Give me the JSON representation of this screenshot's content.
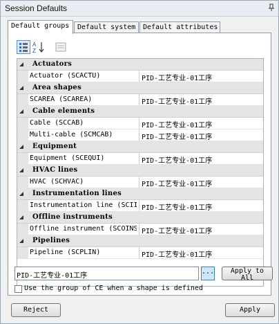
{
  "window": {
    "title": "Session Defaults"
  },
  "tabs": [
    {
      "label": "Default groups",
      "active": true
    },
    {
      "label": "Default system",
      "active": false
    },
    {
      "label": "Default attributes",
      "active": false
    }
  ],
  "toolbar": {
    "icons": [
      "categorized-view-icon",
      "sort-alphabetical-icon",
      "property-pages-icon"
    ]
  },
  "groups": [
    {
      "label": "Actuators",
      "items": [
        {
          "name": "Actuator (SCACTU)",
          "value": "PID-工艺专业-01工序"
        }
      ]
    },
    {
      "label": "Area shapes",
      "items": [
        {
          "name": "SCAREA (SCAREA)",
          "value": "PID-工艺专业-01工序"
        }
      ]
    },
    {
      "label": "Cable elements",
      "items": [
        {
          "name": "Cable (SCCAB)",
          "value": "PID-工艺专业-01工序"
        },
        {
          "name": "Multi-cable (SCMCAB)",
          "value": "PID-工艺专业-01工序"
        }
      ]
    },
    {
      "label": "Equipment",
      "items": [
        {
          "name": "Equipment (SCEQUI)",
          "value": "PID-工艺专业-01工序"
        }
      ]
    },
    {
      "label": "HVAC lines",
      "items": [
        {
          "name": "HVAC (SCHVAC)",
          "value": "PID-工艺专业-01工序"
        }
      ]
    },
    {
      "label": "Instrumentation lines",
      "items": [
        {
          "name": "Instrumentation line (SCII",
          "value": "PID-工艺专业-01工序"
        }
      ]
    },
    {
      "label": "Offline instruments",
      "items": [
        {
          "name": "Offline instrument (SCOINS",
          "value": "PID-工艺专业-01工序"
        }
      ]
    },
    {
      "label": "Pipelines",
      "items": [
        {
          "name": "Pipeline (SCPLIN)",
          "value": "PID-工艺专业-01工序"
        }
      ]
    }
  ],
  "value_editor": {
    "value": "PID-工艺专业-01工序",
    "browse_label": "...",
    "apply_all_label": "Apply to All"
  },
  "checkbox": {
    "label": "Use the group of CE when a shape is defined",
    "checked": false
  },
  "footer": {
    "reject_label": "Reject",
    "apply_label": "Apply"
  }
}
